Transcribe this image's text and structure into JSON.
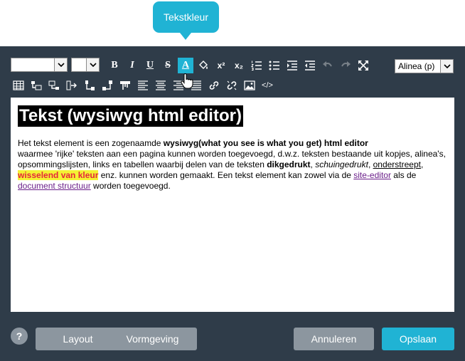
{
  "tooltip": {
    "text": "Tekstkleur"
  },
  "toolbar": {
    "font_family_value": "",
    "font_size_value": "",
    "paragraph_format_value": "Alinea (p)",
    "bold_label": "B",
    "italic_label": "I",
    "underline_label": "U",
    "strike_label": "S",
    "text_color_label": "A",
    "superscript_label": "x²",
    "subscript_label": "x₂",
    "source_label": "</>"
  },
  "editor": {
    "heading": "Tekst (wysiwyg html editor)",
    "p1": "Het tekst element is een zogenaamde ",
    "p1_bold": "wysiwyg(what you see is what you get) html editor",
    "p2": "waarmee 'rijke' teksten aan een pagina kunnen worden toegevoegd, d.w.z. teksten bestaande uit kopjes, alinea's, opsommingslijsten, links en tabellen waarbij delen van de teksten ",
    "p2_bold": "dikgedrukt",
    "p2_sep1": ", ",
    "p2_italic": "schuingedrukt",
    "p2_sep2": ", ",
    "p2_underline": "onderstreept",
    "p2_sep3": ", ",
    "p2_highlight": "wisselend van kleur",
    "p2_rest": " enz. kunnen worden gemaakt. Een tekst element kan zowel via de ",
    "link1": "site-editor",
    "p2_mid": " als de ",
    "link2": "document structuur",
    "p2_end": " worden toegevoegd."
  },
  "footer": {
    "help_label": "?",
    "layout_label": "Layout",
    "vormgeving_label": "Vormgeving",
    "cancel_label": "Annuleren",
    "save_label": "Opslaan"
  },
  "colors": {
    "dialog_bg": "#2f3c49",
    "accent": "#20b3d4",
    "grey_button": "#8c969f",
    "highlight_bg": "#f4f234",
    "highlight_text": "#e5263b",
    "link": "#6b1f8a"
  }
}
